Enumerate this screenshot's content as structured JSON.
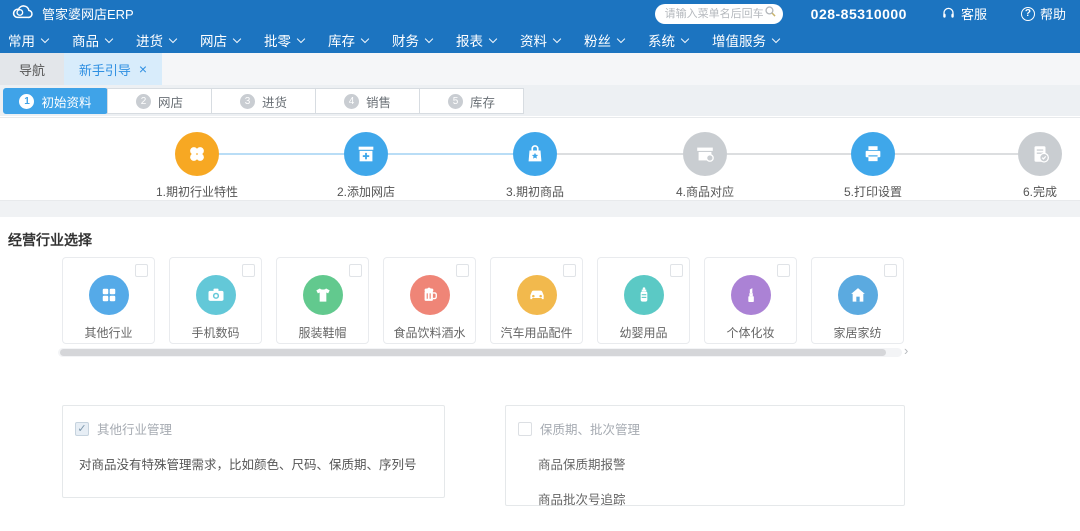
{
  "header": {
    "logo_text": "管家婆网店ERP",
    "search_placeholder": "请输入菜单名后回车",
    "phone": "028-85310000",
    "service_label": "客服",
    "help_label": "帮助",
    "help_glyph": "?"
  },
  "menu": {
    "items": [
      "常用",
      "商品",
      "进货",
      "网店",
      "批零",
      "库存",
      "财务",
      "报表",
      "资料",
      "粉丝",
      "系统",
      "增值服务"
    ]
  },
  "tabs": {
    "nav_label": "导航",
    "active_label": "新手引导",
    "close_glyph": "×"
  },
  "step_tabs": [
    {
      "num": "1",
      "label": "初始资料",
      "active": true
    },
    {
      "num": "2",
      "label": "网店",
      "active": false
    },
    {
      "num": "3",
      "label": "进货",
      "active": false
    },
    {
      "num": "4",
      "label": "销售",
      "active": false
    },
    {
      "num": "5",
      "label": "库存",
      "active": false
    }
  ],
  "wizard": {
    "steps": [
      {
        "label": "1.期初行业特性",
        "state": "current"
      },
      {
        "label": "2.添加网店",
        "state": "done"
      },
      {
        "label": "3.期初商品",
        "state": "done"
      },
      {
        "label": "4.商品对应",
        "state": "todo"
      },
      {
        "label": "5.打印设置",
        "state": "done"
      },
      {
        "label": "6.完成",
        "state": "todo"
      }
    ]
  },
  "section_title": "经营行业选择",
  "categories": [
    {
      "label": "其他行业",
      "color": "#55aae8",
      "icon": "grid-icon"
    },
    {
      "label": "手机数码",
      "color": "#63c8d8",
      "icon": "camera-icon"
    },
    {
      "label": "服装鞋帽",
      "color": "#62c98e",
      "icon": "tshirt-icon"
    },
    {
      "label": "食品饮料酒水",
      "color": "#ef8577",
      "icon": "beer-icon"
    },
    {
      "label": "汽车用品配件",
      "color": "#f2b94d",
      "icon": "car-icon"
    },
    {
      "label": "幼婴用品",
      "color": "#5bc9c5",
      "icon": "bottle-icon"
    },
    {
      "label": "个体化妆",
      "color": "#ab82d5",
      "icon": "lipstick-icon"
    },
    {
      "label": "家居家纺",
      "color": "#5baae0",
      "icon": "home-icon"
    }
  ],
  "options": {
    "other_industry": {
      "label": "其他行业管理",
      "checked": true,
      "check_glyph": "✓",
      "desc": "对商品没有特殊管理需求，比如颜色、尺码、保质期、序列号"
    },
    "shelf_life": {
      "label": "保质期、批次管理",
      "checked": false,
      "line1": "商品保质期报警",
      "line2": "商品批次号追踪"
    }
  },
  "scrollbar": {
    "arrow_glyph": "›"
  },
  "colors": {
    "header_blue": "#1c74c0",
    "accent_blue": "#3fa3e8",
    "step_orange": "#f7a823",
    "step_gray": "#c9cdd1",
    "active_tab_bg": "#d8ecfb"
  }
}
